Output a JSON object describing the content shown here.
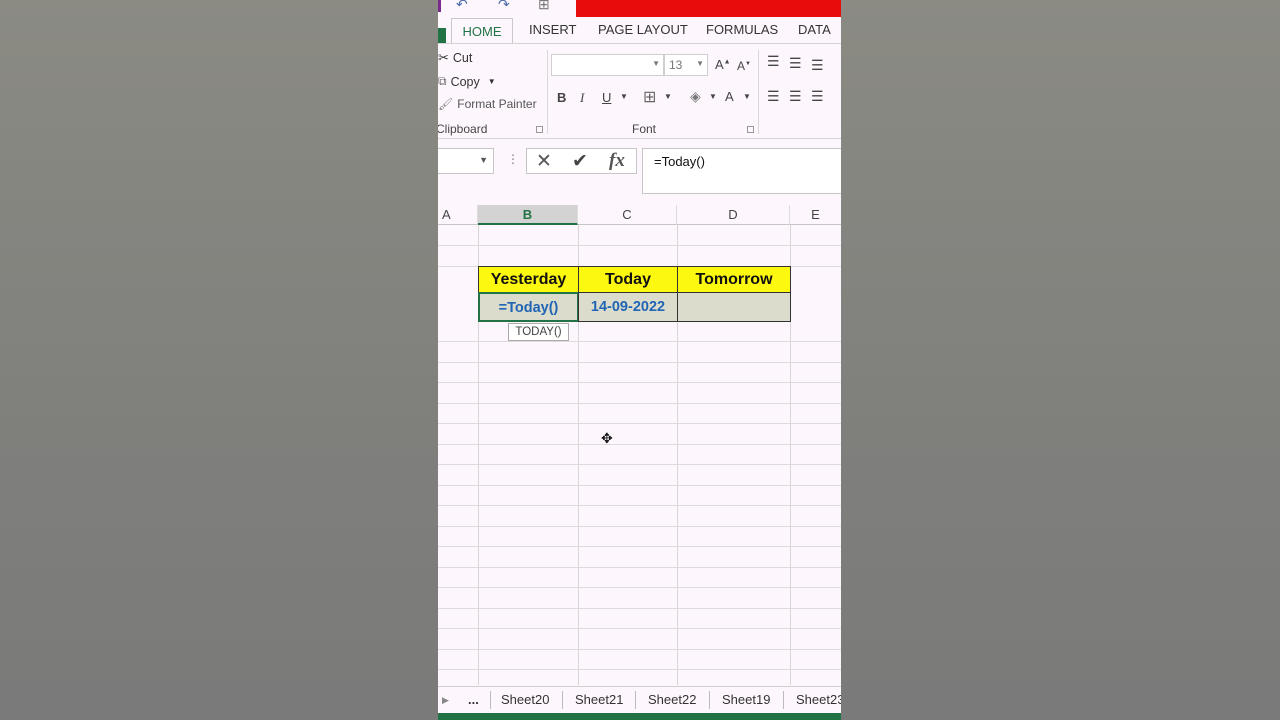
{
  "ribbon": {
    "tabs": [
      "HOME",
      "INSERT",
      "PAGE LAYOUT",
      "FORMULAS",
      "DATA"
    ],
    "clipboard": {
      "cut_label": "Cut",
      "copy_label": "Copy",
      "format_painter_label": "Format Painter",
      "group_label": "Clipboard"
    },
    "font": {
      "font_name": "",
      "font_size": "13",
      "group_label": "Font",
      "bold": "B",
      "italic": "I",
      "underline": "U"
    }
  },
  "formula_bar": {
    "name_box": "",
    "cancel_icon": "✕",
    "enter_icon": "✔",
    "fx_label": "fx",
    "formula": "=Today()"
  },
  "grid": {
    "columns": [
      "A",
      "B",
      "C",
      "D",
      "E"
    ],
    "selected_column": "B",
    "headers": {
      "yesterday": "Yesterday",
      "today": "Today",
      "tomorrow": "Tomorrow"
    },
    "values": {
      "yesterday": "=Today()",
      "today": "14-09-2022",
      "tomorrow": ""
    },
    "tooltip": "TODAY()"
  },
  "sheets": {
    "more": "...",
    "tabs": [
      "Sheet20",
      "Sheet21",
      "Sheet22",
      "Sheet19",
      "Sheet23"
    ]
  },
  "colors": {
    "accent": "#217346",
    "header_fill": "#fdf80f",
    "value_fill": "#dcdccc",
    "value_text": "#1f64b5",
    "banner": "#e80c0c"
  }
}
